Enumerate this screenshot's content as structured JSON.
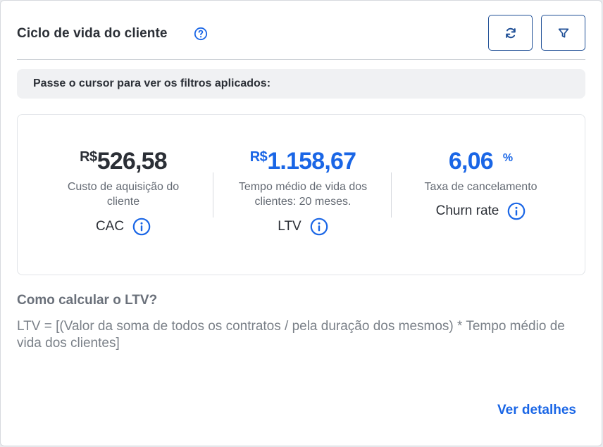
{
  "header": {
    "title": "Ciclo de vida do cliente"
  },
  "filters_hint": "Passe o cursor para ver os filtros aplicados:",
  "metrics": {
    "cac": {
      "currency": "R$",
      "value": "526,58",
      "description": "Custo de aquisição do cliente",
      "label": "CAC"
    },
    "ltv": {
      "currency": "R$",
      "value": "1.158,67",
      "description": "Tempo médio de vida dos clientes: 20 meses.",
      "label": "LTV"
    },
    "churn": {
      "value": "6,06",
      "unit": "%",
      "description": "Taxa de cancelamento",
      "label": "Churn rate"
    }
  },
  "how_to": {
    "title": "Como calcular o LTV?",
    "formula": "LTV = [(Valor da soma de todos os contratos / pela duração dos mesmos) * Tempo médio de vida dos clientes]"
  },
  "details_link": "Ver detalhes",
  "colors": {
    "accent": "#1a66e6",
    "button_border": "#1f4f96",
    "text_dark": "#2b2f36",
    "text_muted": "#646a73"
  }
}
